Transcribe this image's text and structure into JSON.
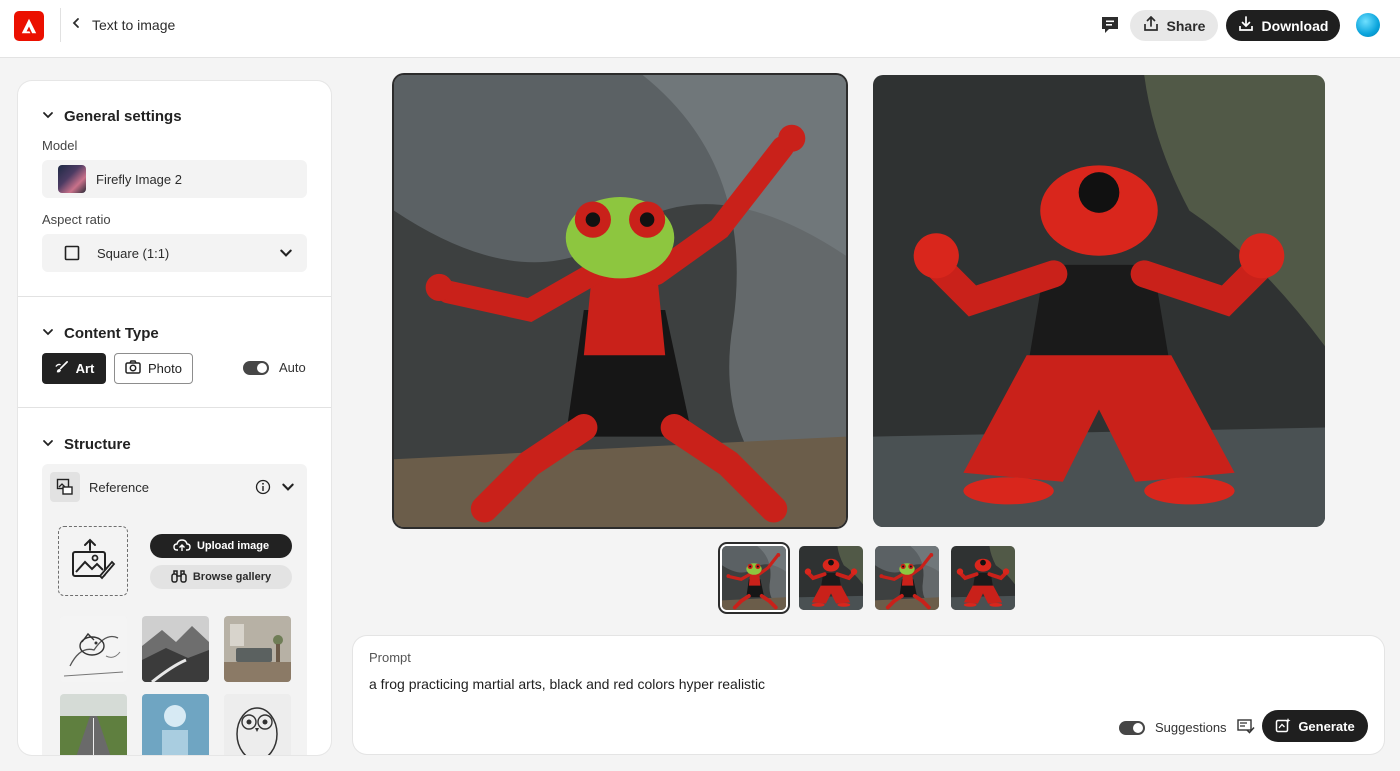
{
  "header": {
    "title": "Text to image",
    "share_label": "Share",
    "download_label": "Download"
  },
  "settings": {
    "general": {
      "heading": "General settings",
      "model_label": "Model",
      "model_value": "Firefly Image 2",
      "aspect_label": "Aspect ratio",
      "aspect_value": "Square (1:1)"
    },
    "content_type": {
      "heading": "Content Type",
      "art_label": "Art",
      "photo_label": "Photo",
      "auto_label": "Auto"
    },
    "structure": {
      "heading": "Structure",
      "reference_label": "Reference",
      "upload_label": "Upload image",
      "gallery_label": "Browse gallery"
    }
  },
  "results": {
    "selected_index": 0,
    "thumbnail_count": 4
  },
  "prompt": {
    "label": "Prompt",
    "text": "a frog practicing martial arts, black and red colors hyper realistic",
    "suggestions_label": "Suggestions",
    "generate_label": "Generate"
  },
  "colors": {
    "brand": "#eb1000",
    "dark_button": "#1f1f1f",
    "frog_red": "#d9261c",
    "frog_green": "#8dc63f"
  }
}
